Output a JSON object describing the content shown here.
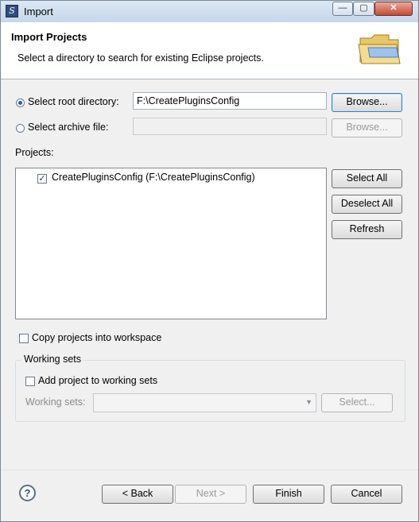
{
  "window": {
    "title": "Import",
    "app_icon_glyph": "S",
    "minimize_glyph": "—",
    "maximize_glyph": "▢",
    "close_glyph": "✕"
  },
  "banner": {
    "title": "Import Projects",
    "message": "Select a directory to search for existing Eclipse projects.",
    "icon": "folder-icon"
  },
  "source": {
    "root_option": {
      "label": "Select root directory:",
      "selected": true
    },
    "root_value": "F:\\CreatePluginsConfig",
    "root_browse": "Browse...",
    "archive_option": {
      "label": "Select archive file:",
      "selected": false
    },
    "archive_value": "",
    "archive_browse": "Browse..."
  },
  "projects": {
    "label": "Projects:",
    "items": [
      {
        "label": "CreatePluginsConfig (F:\\CreatePluginsConfig)",
        "checked": true
      }
    ],
    "select_all": "Select All",
    "deselect_all": "Deselect All",
    "refresh": "Refresh"
  },
  "copy_option": {
    "label": "Copy projects into workspace",
    "checked": false
  },
  "working_sets": {
    "group_title": "Working sets",
    "add_label": "Add project to working sets",
    "sets_label": "Working sets:",
    "select_button": "Select..."
  },
  "footer": {
    "help_glyph": "?",
    "back": "< Back",
    "next": "Next >",
    "finish": "Finish",
    "cancel": "Cancel"
  },
  "colors": {
    "title_bar": "#c6d7ea",
    "close_button": "#c24b35",
    "focus_border": "#3c7fb1"
  }
}
